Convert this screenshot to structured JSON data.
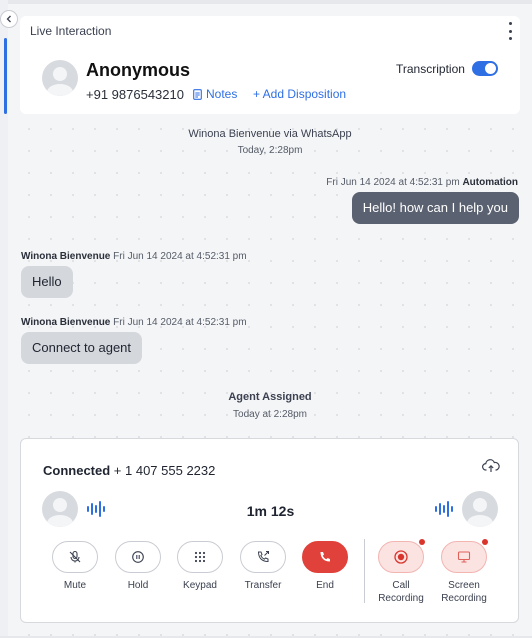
{
  "panel": {
    "tab_label": "Live Interaction"
  },
  "contact": {
    "name": "Anonymous",
    "phone": "+91 9876543210",
    "notes_label": "Notes",
    "add_disposition_label": "+ Add Disposition",
    "transcription_label": "Transcription",
    "transcription_on": true
  },
  "conversation": {
    "channel_title": "Winona Bienvenue via WhatsApp",
    "channel_time": "Today, 2:28pm",
    "messages": [
      {
        "meta": "Fri Jun 14 2024 at 4:52:31 pm",
        "sender": "Automation",
        "text": "Hello! how can I help you",
        "direction": "out"
      },
      {
        "sender": "Winona Bienvenue",
        "meta": "Fri Jun 14 2024 at 4:52:31 pm",
        "text": "Hello",
        "direction": "in"
      },
      {
        "sender": "Winona Bienvenue",
        "meta": "Fri Jun 14 2024 at 4:52:31 pm",
        "text": "Connect to agent",
        "direction": "in"
      }
    ],
    "agent_assigned_title": "Agent Assigned",
    "agent_assigned_time": "Today at 2:28pm"
  },
  "call": {
    "status": "Connected",
    "number": "+ 1 407 555 2232",
    "timer": "1m 12s",
    "controls": [
      {
        "label": "Mute",
        "icon": "mic-off-icon"
      },
      {
        "label": "Hold",
        "icon": "pause-icon"
      },
      {
        "label": "Keypad",
        "icon": "keypad-icon"
      },
      {
        "label": "Transfer",
        "icon": "phone-transfer-icon"
      },
      {
        "label": "End",
        "icon": "phone-end-icon"
      }
    ],
    "recording": [
      {
        "line1": "Call",
        "line2": "Recording",
        "icon": "record-icon"
      },
      {
        "line1": "Screen",
        "line2": "Recording",
        "icon": "monitor-icon"
      }
    ]
  },
  "colors": {
    "accent": "#2f6fe4",
    "end_call": "#e0413a",
    "bubble_out": "#5a6170",
    "bubble_in": "#d4d7dc"
  }
}
